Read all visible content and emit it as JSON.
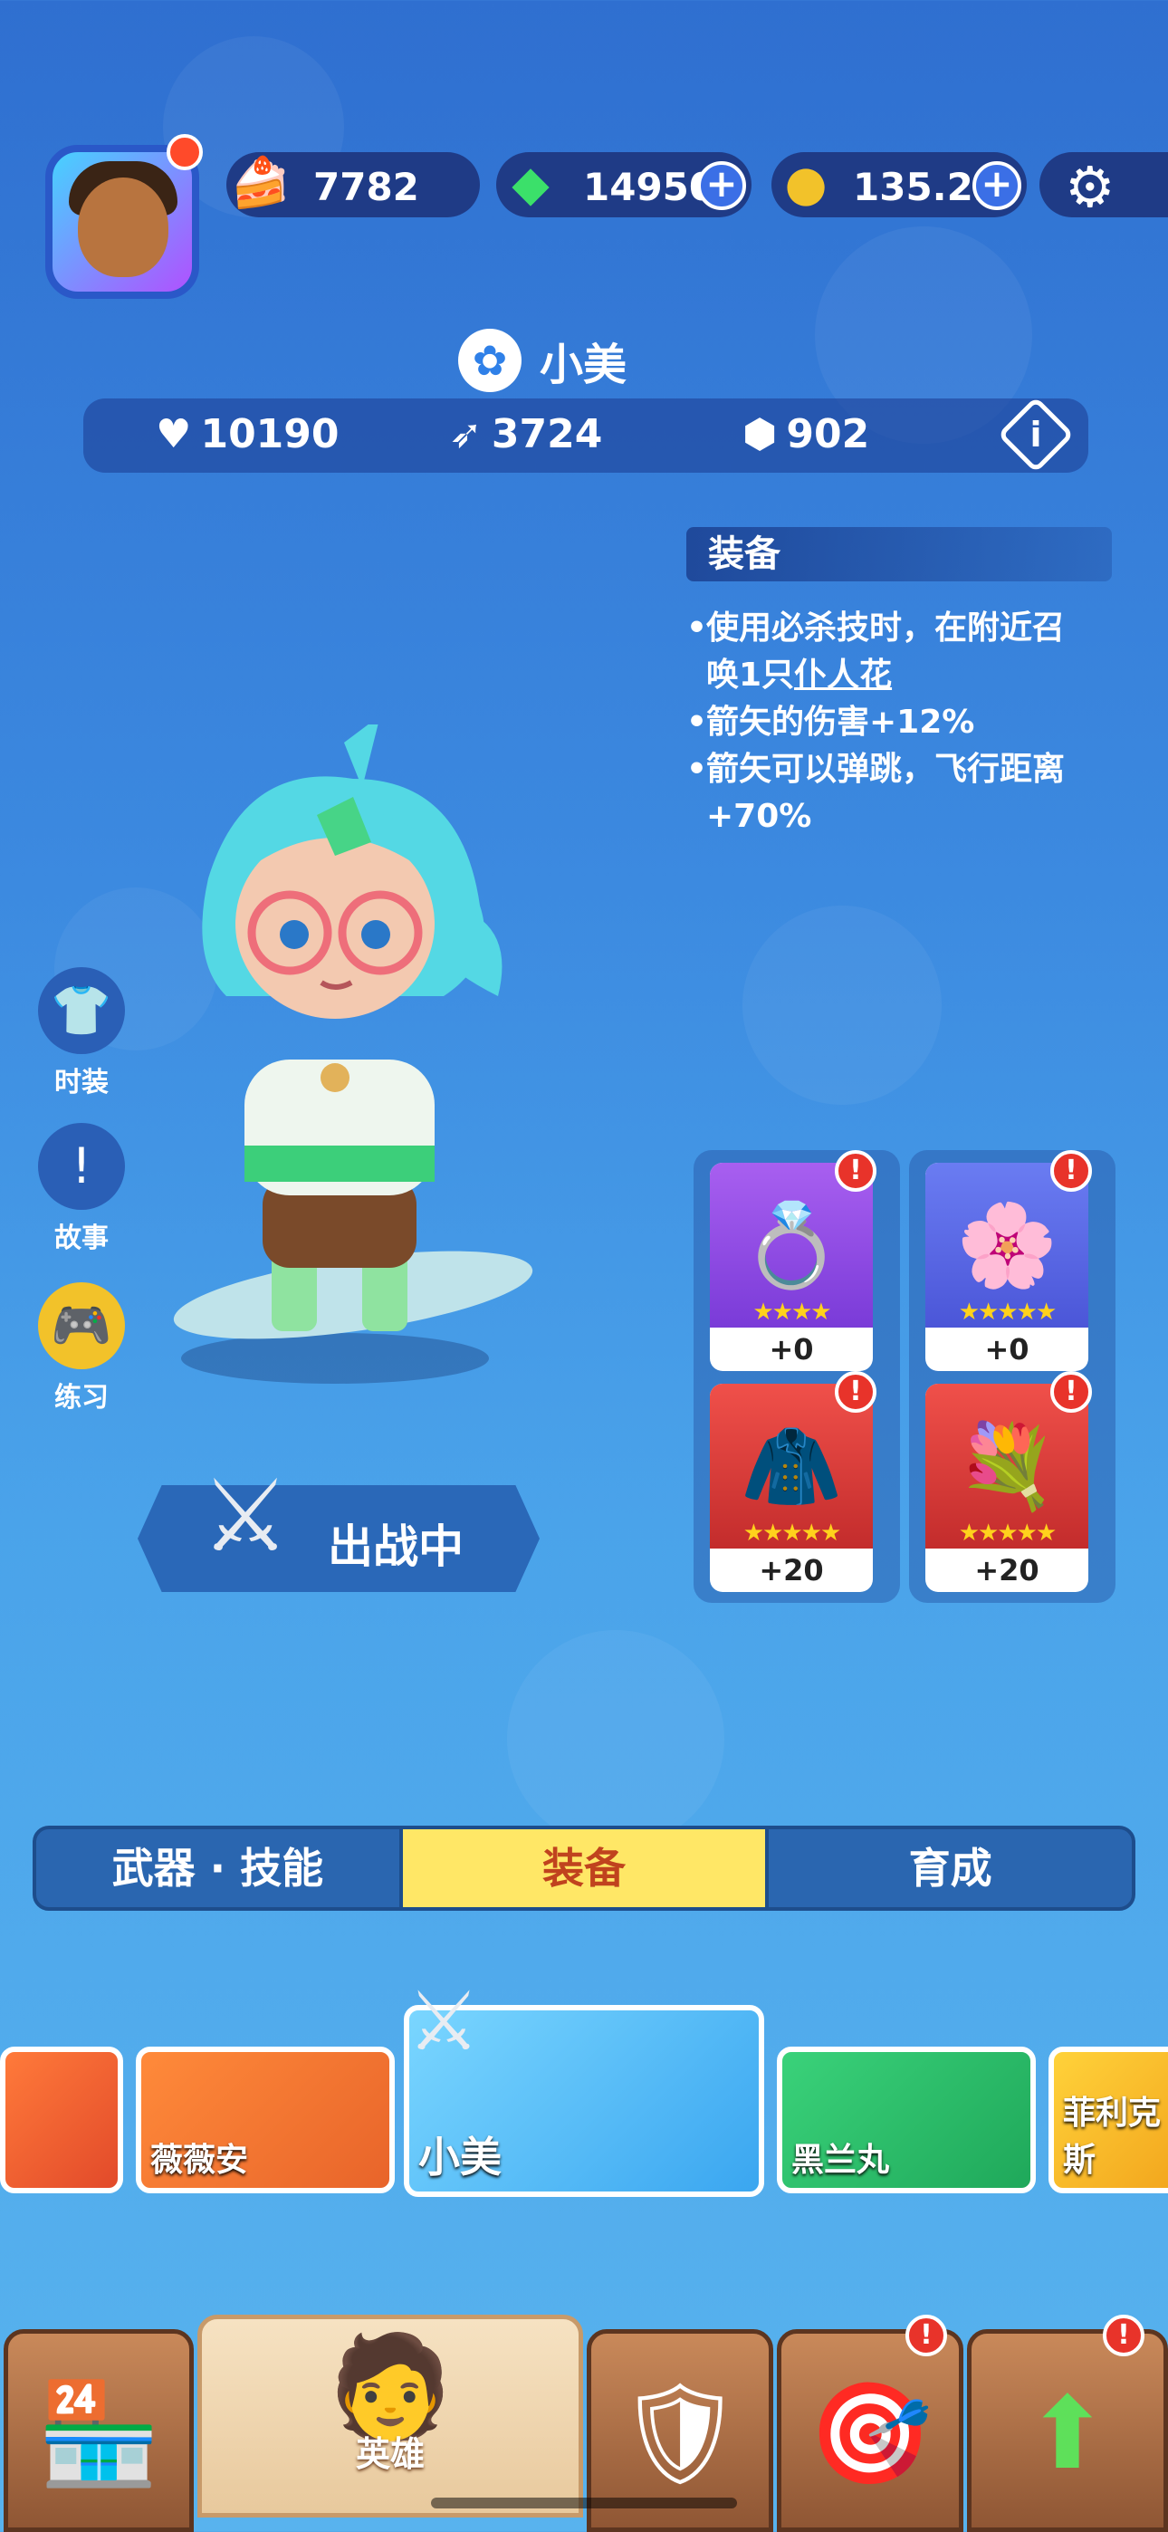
{
  "resources": {
    "cake": "7782",
    "gems": "14950",
    "coins": "135.2K",
    "plus": "+"
  },
  "hero": {
    "name": "小美",
    "health": "10190",
    "attack": "3724",
    "defense": "902"
  },
  "equipment": {
    "title": "装备",
    "line1a": "使用必杀技时，在附近召",
    "line1b": "唤1只",
    "line1link": "仆人花",
    "line2": "箭矢的伤害+12%",
    "line3": "箭矢可以弹跳，飞行距离",
    "line3b": "+70%"
  },
  "side": {
    "costume": "时装",
    "story": "故事",
    "practice": "练习"
  },
  "deploy": "出战中",
  "cards": [
    {
      "level": "+0",
      "stars": "★★★★"
    },
    {
      "level": "+0",
      "stars": "★★★★★"
    },
    {
      "level": "+20",
      "stars": "★★★★★"
    },
    {
      "level": "+20",
      "stars": "★★★★★"
    }
  ],
  "alert": "!",
  "tabs": {
    "weapon_skill": "武器 · 技能",
    "gear": "装备",
    "growth": "育成"
  },
  "carousel": {
    "h2": "薇薇安",
    "h3": "小美",
    "h4": "黑兰丸",
    "h5": "菲利克斯"
  },
  "nav": {
    "hero": "英雄"
  },
  "colors": {
    "active_tab": "#ffe766",
    "alert": "#e8332a"
  }
}
